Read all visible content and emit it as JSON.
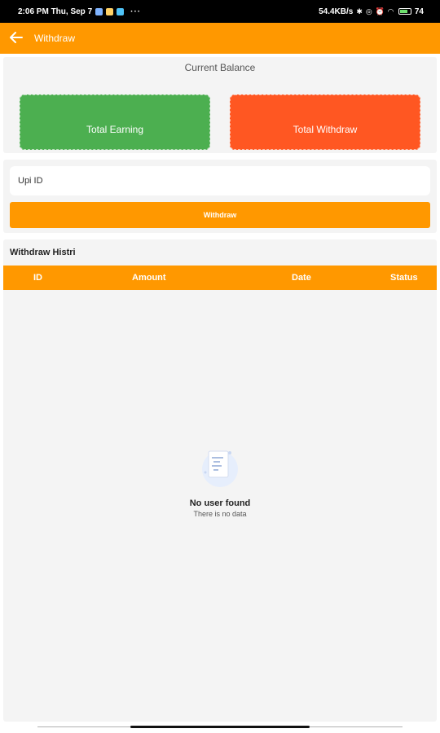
{
  "status_bar": {
    "time_date": "2:06 PM Thu, Sep 7",
    "network_speed": "54.4KB/s",
    "battery_level": "74"
  },
  "app_bar": {
    "back_icon": "arrow-left-icon",
    "title": "Withdraw"
  },
  "balance": {
    "title": "Current Balance",
    "total_earning_label": "Total Earning",
    "total_withdraw_label": "Total Withdraw",
    "earning_color": "#4caf50",
    "withdraw_color": "#ff5722"
  },
  "withdraw_form": {
    "upi_placeholder": "Upi ID",
    "upi_value": "",
    "submit_label": "Withdraw"
  },
  "history": {
    "title": "Withdraw Histri",
    "columns": [
      "ID",
      "Amount",
      "Date",
      "Status"
    ],
    "rows": [],
    "empty_title": "No user found",
    "empty_subtitle": "There is no data",
    "empty_icon": "empty-document-icon"
  },
  "theme": {
    "accent": "#ff9800"
  }
}
